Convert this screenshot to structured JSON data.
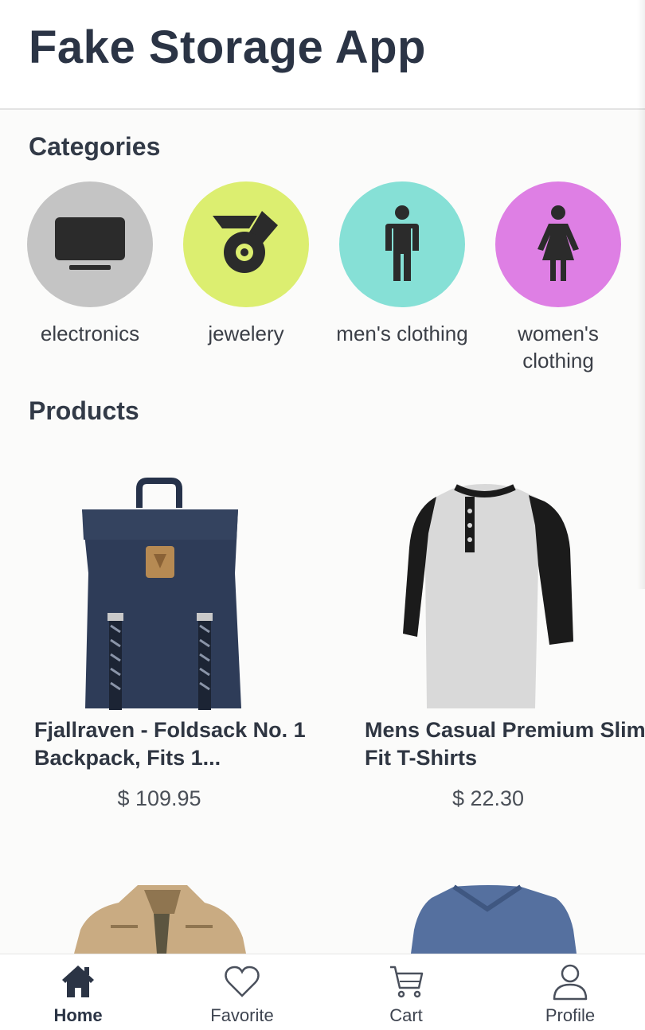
{
  "app": {
    "title": "Fake Storage App"
  },
  "sections": {
    "categories": "Categories",
    "products": "Products"
  },
  "categories": [
    {
      "label": "electronics",
      "icon": "tv-icon",
      "color": "#c4c4c4"
    },
    {
      "label": "jewelery",
      "icon": "ring-icon",
      "color": "#dcee70"
    },
    {
      "label": "men's clothing",
      "icon": "man-icon",
      "color": "#86e0d6"
    },
    {
      "label": "women's clothing",
      "icon": "woman-icon",
      "color": "#de7fe4"
    }
  ],
  "products": [
    {
      "name": "Fjallraven - Foldsack No. 1 Backpack, Fits 1...",
      "price": "$ 109.95",
      "image": "backpack-image"
    },
    {
      "name": "Mens Casual Premium Slim Fit T-Shirts",
      "price": "$ 22.30",
      "image": "tshirt-image"
    },
    {
      "image": "jacket-image"
    },
    {
      "image": "blue-shirt-image"
    }
  ],
  "nav": {
    "active": "Home",
    "items": [
      {
        "label": "Home",
        "icon": "home-icon"
      },
      {
        "label": "Favorite",
        "icon": "heart-icon"
      },
      {
        "label": "Cart",
        "icon": "cart-icon"
      },
      {
        "label": "Profile",
        "icon": "user-icon"
      }
    ]
  },
  "colors": {
    "text": "#2b3445",
    "icon_dark": "#2b3445"
  }
}
